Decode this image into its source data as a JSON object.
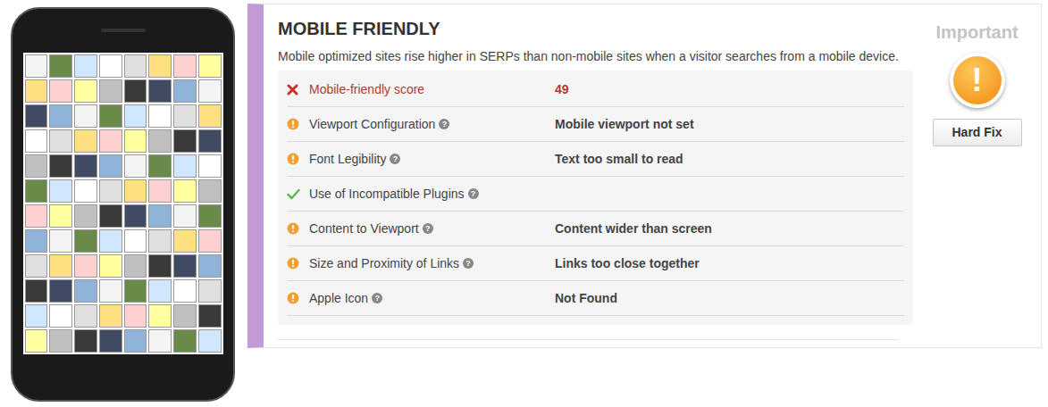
{
  "section": {
    "title": "MOBILE FRIENDLY",
    "description": "Mobile optimized sites rise higher in SERPs than non-mobile sites when a visitor searches from a mobile device."
  },
  "help_glyph": "?",
  "rows": [
    {
      "label": "Mobile-friendly score",
      "value": "49",
      "kind": "fail",
      "help": false
    },
    {
      "label": "Viewport Configuration",
      "value": "Mobile viewport not set",
      "kind": "warning",
      "help": true
    },
    {
      "label": "Font Legibility",
      "value": "Text too small to read",
      "kind": "warning",
      "help": true
    },
    {
      "label": "Use of Incompatible Plugins",
      "value": "",
      "kind": "pass",
      "help": true
    },
    {
      "label": "Content to Viewport",
      "value": "Content wider than screen",
      "kind": "warning",
      "help": true
    },
    {
      "label": "Size and Proximity of Links",
      "value": "Links too close together",
      "kind": "warning",
      "help": true
    },
    {
      "label": "Apple Icon",
      "value": "Not Found",
      "kind": "warning",
      "help": true
    }
  ],
  "priority": {
    "label": "Important",
    "glyph": "!"
  },
  "buttons": [
    "Hard Fix"
  ]
}
